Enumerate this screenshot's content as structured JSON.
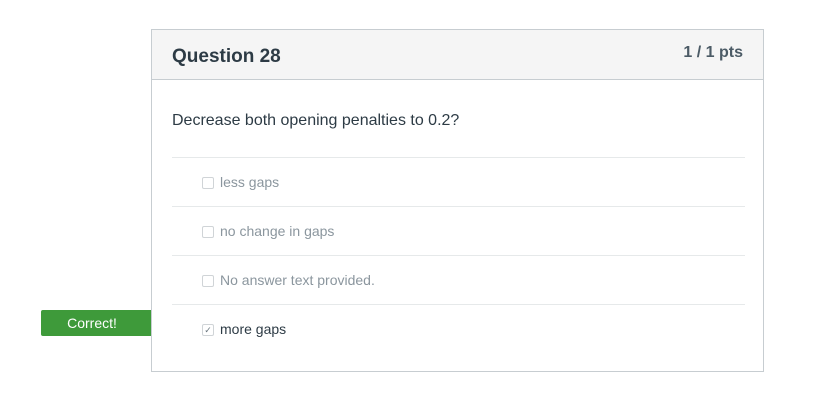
{
  "question": {
    "title": "Question 28",
    "points": "1 / 1 pts",
    "text": "Decrease both opening penalties to 0.2?"
  },
  "answers": [
    {
      "label": "less gaps",
      "checked": false
    },
    {
      "label": "no change in gaps",
      "checked": false
    },
    {
      "label": "No answer text provided.",
      "checked": false
    },
    {
      "label": "more gaps",
      "checked": true
    }
  ],
  "feedback": {
    "label": "Correct!",
    "color": "#3e9a3a"
  },
  "icons": {
    "checked": "✓"
  }
}
